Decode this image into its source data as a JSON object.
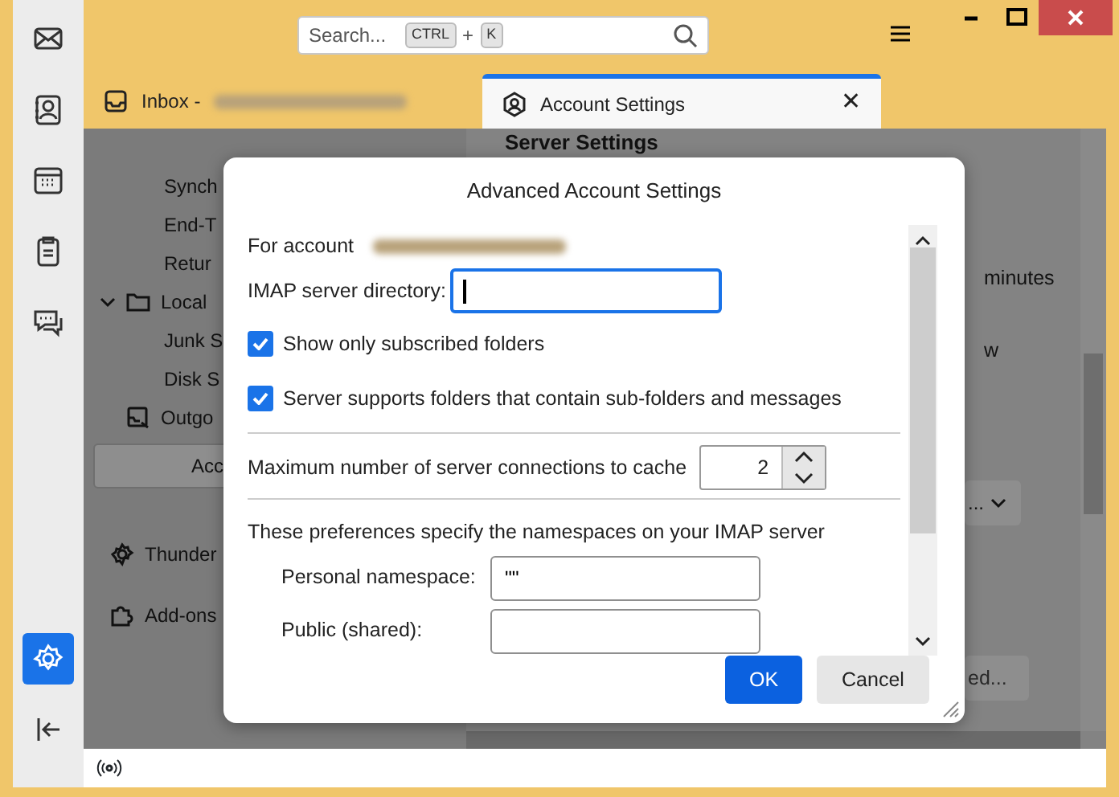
{
  "window": {
    "controls": [
      {
        "kind": "minimize"
      },
      {
        "kind": "maximize"
      },
      {
        "kind": "close"
      }
    ]
  },
  "spaces": [
    {
      "kind": "mail",
      "selected": false
    },
    {
      "kind": "contacts",
      "selected": false
    },
    {
      "kind": "calendar",
      "selected": false
    },
    {
      "kind": "tasks",
      "selected": false
    },
    {
      "kind": "chat",
      "selected": false
    },
    {
      "kind": "settings",
      "selected": true
    },
    {
      "kind": "collapse",
      "selected": false
    }
  ],
  "search": {
    "placeholder": "Search...",
    "keys": [
      "CTRL",
      "K"
    ],
    "joiner": "+"
  },
  "tabs": [
    {
      "label": "Inbox -",
      "kind": "inbox",
      "selected": false,
      "redacted": true
    },
    {
      "label": "Account Settings",
      "kind": "account",
      "selected": true,
      "closable": true,
      "close": "✕"
    }
  ],
  "account_tree": [
    {
      "label": "Synch",
      "kind": "item"
    },
    {
      "label": "End-T",
      "kind": "item"
    },
    {
      "label": "Retur",
      "kind": "item"
    },
    {
      "label": "Local",
      "kind": "folder",
      "expanded": true
    },
    {
      "label": "Junk S",
      "kind": "item"
    },
    {
      "label": "Disk S",
      "kind": "item"
    },
    {
      "label": "Outgo",
      "kind": "outgoing"
    },
    {
      "label": "Acc",
      "kind": "button"
    },
    {
      "label": "Thunder",
      "kind": "settings"
    },
    {
      "label": "Add-ons",
      "kind": "addons"
    }
  ],
  "settings_page": {
    "heading": "Server Settings",
    "fragments": [
      "minutes",
      "w"
    ],
    "dropdown": "...",
    "button": "ed..."
  },
  "dialog": {
    "title": "Advanced Account Settings",
    "for_account": "For account",
    "imap_directory": {
      "label": "IMAP server directory:",
      "focused": true
    },
    "checkboxes": [
      {
        "label": "Show only subscribed folders",
        "checked": true
      },
      {
        "label": "Server supports folders that contain sub-folders and messages",
        "checked": true
      }
    ],
    "max_connections": {
      "label": "Maximum number of server connections to cache",
      "value": "2"
    },
    "namespaces_note": "These preferences specify the namespaces on your IMAP server",
    "namespaces": [
      {
        "label": "Personal namespace:",
        "value": "\"\""
      },
      {
        "label": "Public (shared):"
      }
    ],
    "buttons": [
      {
        "label": "OK",
        "kind": "primary"
      },
      {
        "label": "Cancel",
        "kind": "secondary"
      }
    ]
  }
}
